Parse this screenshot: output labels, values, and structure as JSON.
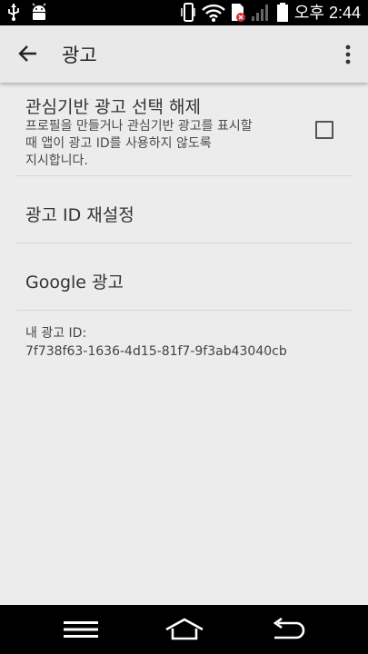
{
  "status_bar": {
    "time": "오후 2:44",
    "icons": [
      "usb-icon",
      "android-debug-icon",
      "vibrate-icon",
      "wifi-icon",
      "sim-error-icon",
      "signal-icon",
      "battery-icon"
    ]
  },
  "app_bar": {
    "title": "광고",
    "back_icon": "arrow-back-icon",
    "overflow_icon": "more-vert-icon"
  },
  "preferences": {
    "opt_out": {
      "title": "관심기반 광고 선택 해제",
      "summary_lines": [
        "프로필을 만들거나 관심기반 광고를 표시할",
        "때 앱이 광고 ID를 사용하지 않도록",
        "지시합니다."
      ],
      "checked": false
    },
    "reset_id": {
      "title": "광고 ID 재설정"
    },
    "google_ads": {
      "title": "Google 광고"
    }
  },
  "ad_id": {
    "label": "내 광고 ID:",
    "value": "7f738f63-1636-4d15-81f7-9f3ab43040cb"
  },
  "nav_bar": {
    "icons": [
      "menu-icon",
      "home-icon",
      "back-icon"
    ]
  }
}
